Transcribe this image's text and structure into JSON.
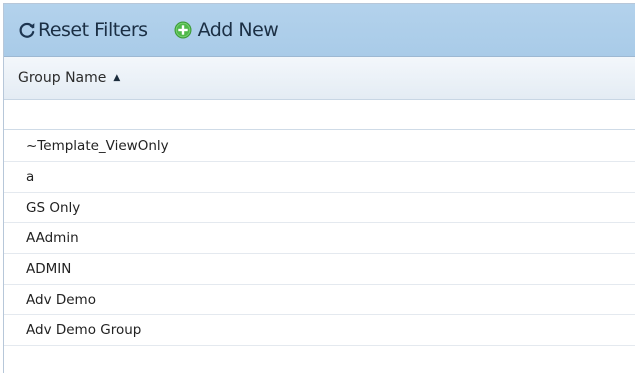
{
  "toolbar": {
    "reset_label": "Reset Filters",
    "add_label": "Add New",
    "colors": {
      "background": "#afcfeb",
      "add_icon": "#4fb84a"
    }
  },
  "grid": {
    "column_header": "Group Name",
    "sort_direction": "ascending",
    "filter_value": "",
    "rows": [
      "~Template_ViewOnly",
      "a",
      "GS Only",
      "AAdmin",
      "ADMIN",
      "Adv Demo",
      "Adv Demo Group"
    ]
  }
}
